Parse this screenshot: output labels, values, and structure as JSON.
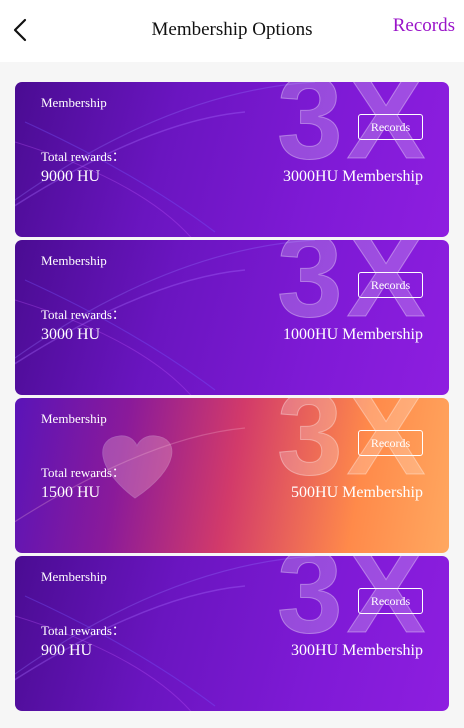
{
  "header": {
    "title": "Membership Options",
    "records_link": "Records",
    "back_icon": "chevron-left-icon"
  },
  "cards": [
    {
      "membership_label": "Membership",
      "records_button": "Records",
      "rewards_label": "Total rewards：",
      "rewards_value": "9000 HU",
      "tier": "3000HU Membership",
      "style": "purple",
      "badge": "3X"
    },
    {
      "membership_label": "Membership",
      "records_button": "Records",
      "rewards_label": "Total rewards：",
      "rewards_value": "3000 HU",
      "tier": "1000HU Membership",
      "style": "purple",
      "badge": "3X"
    },
    {
      "membership_label": "Membership",
      "records_button": "Records",
      "rewards_label": "Total rewards：",
      "rewards_value": "1500 HU",
      "tier": "500HU Membership",
      "style": "orange",
      "badge": "3X"
    },
    {
      "membership_label": "Membership",
      "records_button": "Records",
      "rewards_label": "Total rewards：",
      "rewards_value": "900 HU",
      "tier": "300HU Membership",
      "style": "purple",
      "badge": "3X"
    }
  ],
  "colors": {
    "accent": "#9a14c9",
    "card_purple": "#6a15c0",
    "card_orange": "#ff8a4a",
    "page_bg": "#f6f6f6"
  }
}
